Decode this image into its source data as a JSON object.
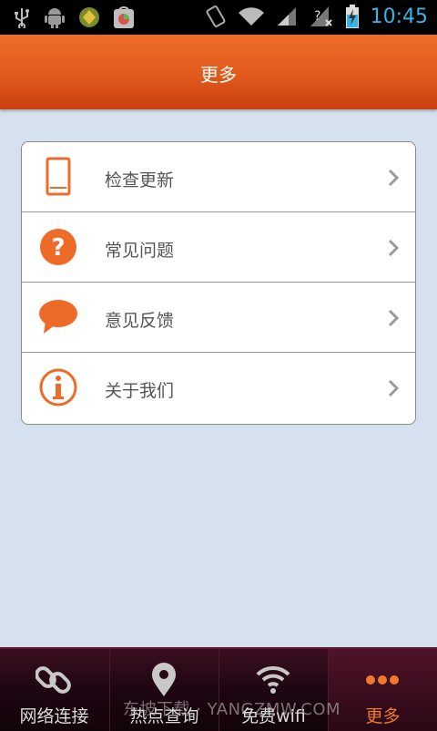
{
  "status_bar": {
    "time": "10:45",
    "icons": [
      "usb-icon",
      "android-icon",
      "app-icon",
      "store-icon",
      "vibrate-icon",
      "wifi-icon",
      "signal-icon",
      "no-sim-icon",
      "battery-charging-icon"
    ],
    "time_color": "#33b5e5"
  },
  "header": {
    "title": "更多",
    "color": "#e15a1c"
  },
  "menu": {
    "items": [
      {
        "label": "检查更新",
        "icon": "phone-icon"
      },
      {
        "label": "常见问题",
        "icon": "question-icon"
      },
      {
        "label": "意见反馈",
        "icon": "speech-bubble-icon"
      },
      {
        "label": "关于我们",
        "icon": "info-icon"
      }
    ],
    "accent": "#ee6a28"
  },
  "tabs": [
    {
      "label": "网络连接",
      "icon": "link-icon",
      "active": false
    },
    {
      "label": "热点查询",
      "icon": "location-pin-icon",
      "active": false
    },
    {
      "label": "免费wifi",
      "icon": "wifi-icon",
      "active": false
    },
    {
      "label": "更多",
      "icon": "more-dots-icon",
      "active": true
    }
  ],
  "watermark": "东坡下载 · YANGZMW.COM"
}
